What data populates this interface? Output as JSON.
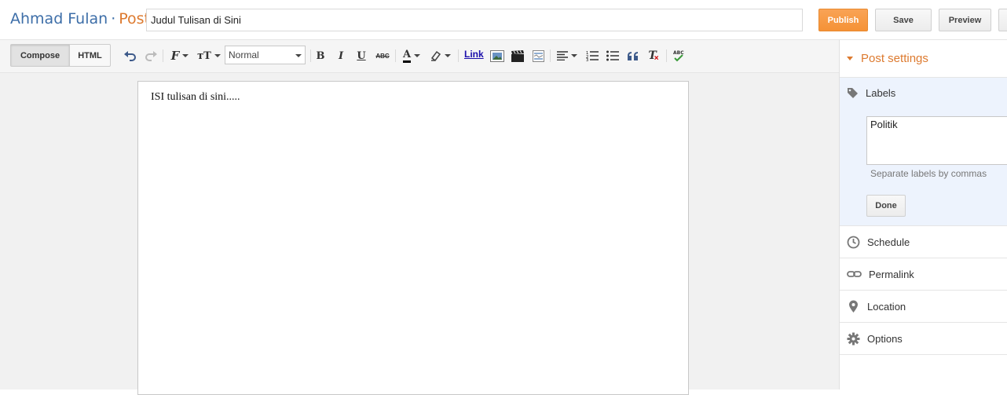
{
  "header": {
    "blog_name": "Ahmad Fulan",
    "separator": "·",
    "section": "Post",
    "post_title": "Judul Tulisan di Sini",
    "publish_label": "Publish",
    "save_label": "Save",
    "preview_label": "Preview"
  },
  "toolbar": {
    "compose_label": "Compose",
    "html_label": "HTML",
    "format_value": "Normal",
    "link_label": "Link",
    "icons": [
      "undo-icon",
      "redo-icon",
      "font-family-icon",
      "font-size-icon",
      "bold-icon",
      "italic-icon",
      "underline-icon",
      "strikethrough-icon",
      "text-color-icon",
      "highlight-icon",
      "link",
      "image-icon",
      "video-icon",
      "jump-break-icon",
      "align-icon",
      "numbered-list-icon",
      "bulleted-list-icon",
      "quote-icon",
      "remove-format-icon",
      "spellcheck-icon"
    ]
  },
  "editor": {
    "body_text": "ISI tulisan di sini....."
  },
  "sidebar": {
    "heading": "Post settings",
    "labels": {
      "title": "Labels",
      "value": "Politik",
      "hint": "Separate labels by commas",
      "done_label": "Done"
    },
    "items": [
      {
        "label": "Schedule",
        "icon": "clock-icon"
      },
      {
        "label": "Permalink",
        "icon": "link-icon"
      },
      {
        "label": "Location",
        "icon": "location-pin-icon"
      },
      {
        "label": "Options",
        "icon": "gear-icon"
      }
    ]
  },
  "colors": {
    "brand_blue": "#3d6ea8",
    "accent_orange": "#dd7a2f",
    "publish_orange": "#f59236",
    "labels_panel_bg": "#edf3fd"
  }
}
